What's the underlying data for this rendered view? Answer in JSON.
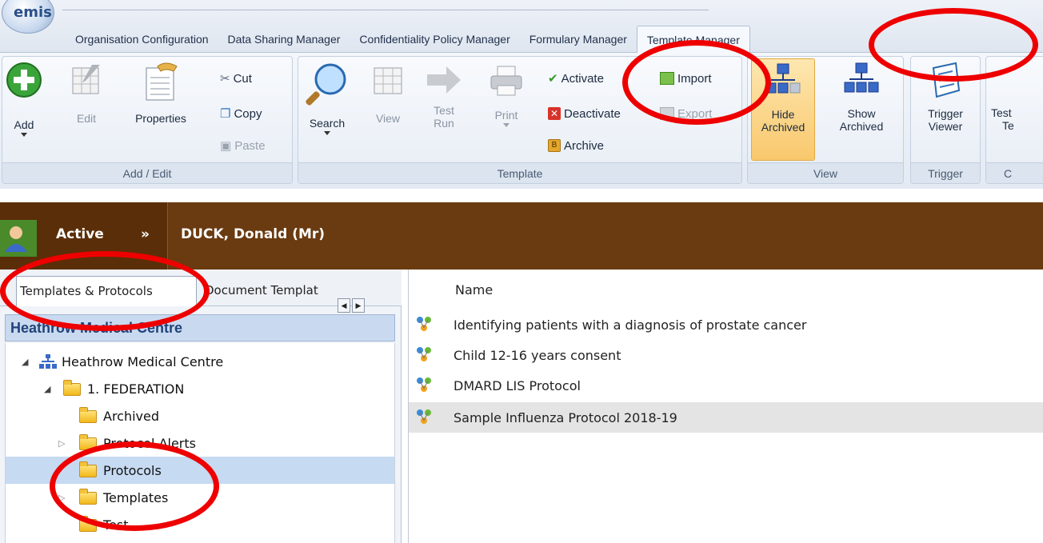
{
  "app": {
    "logo_text": "emis"
  },
  "menu_tabs": [
    {
      "label": "Organisation Configuration"
    },
    {
      "label": "Data Sharing Manager"
    },
    {
      "label": "Confidentiality Policy Manager"
    },
    {
      "label": "Formulary Manager"
    },
    {
      "label": "Template Manager"
    }
  ],
  "ribbon": {
    "add_edit": {
      "label": "Add / Edit",
      "add": "Add",
      "edit": "Edit",
      "properties": "Properties",
      "cut": "Cut",
      "copy": "Copy",
      "paste": "Paste"
    },
    "template": {
      "label": "Template",
      "search": "Search",
      "view": "View",
      "test_run_1": "Test",
      "test_run_2": "Run",
      "print": "Print",
      "activate": "Activate",
      "deactivate": "Deactivate",
      "archive": "Archive",
      "import": "Import",
      "export": "Export"
    },
    "view": {
      "label": "View",
      "hide_1": "Hide",
      "hide_2": "Archived",
      "show_1": "Show",
      "show_2": "Archived"
    },
    "trigger": {
      "label": "Trigger",
      "viewer_1": "Trigger",
      "viewer_2": "Viewer"
    },
    "partial": {
      "label": "C",
      "test_1": "Test",
      "test_2": "Te"
    }
  },
  "banner": {
    "status": "Active",
    "chevron": "»",
    "patient": "DUCK, Donald (Mr)"
  },
  "left_panel": {
    "tabs": [
      {
        "label": "Templates & Protocols"
      },
      {
        "label": "Document Templat"
      }
    ],
    "site_header": "Heathrow Medical Centre",
    "tree": [
      {
        "label": "Heathrow Medical Centre"
      },
      {
        "label": "1. FEDERATION"
      },
      {
        "label": "Archived"
      },
      {
        "label": "Protocol Alerts"
      },
      {
        "label": "Protocols"
      },
      {
        "label": "Templates"
      },
      {
        "label": "Test"
      }
    ]
  },
  "right_panel": {
    "column": "Name",
    "rows": [
      {
        "name": "Identifying patients with a diagnosis of prostate cancer"
      },
      {
        "name": "Child 12-16 years consent"
      },
      {
        "name": "DMARD LIS Protocol"
      },
      {
        "name": "Sample Influenza Protocol 2018-19"
      }
    ]
  },
  "colors": {
    "banner": "#6a3a10",
    "annotation": "#ee0000",
    "selection": "#c6daf2"
  }
}
